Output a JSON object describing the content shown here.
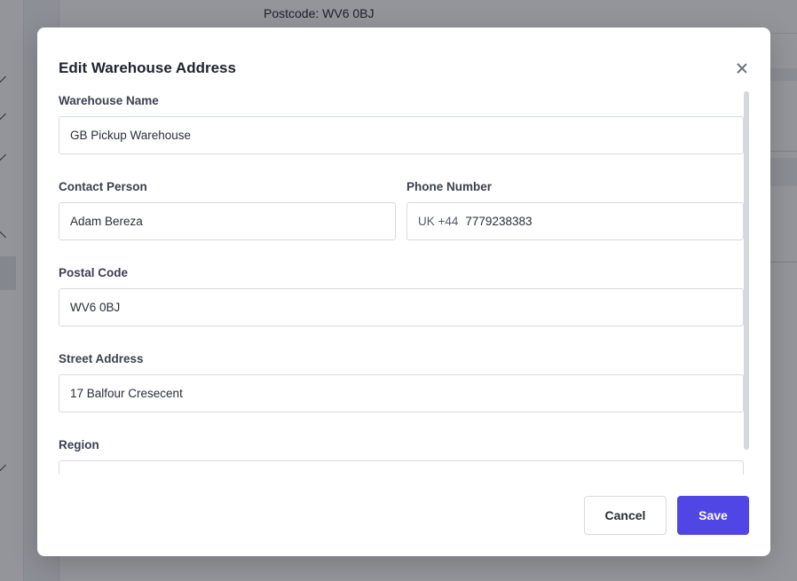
{
  "background": {
    "postcode_text": "Postcode: WV6 0BJ"
  },
  "modal": {
    "title": "Edit Warehouse Address",
    "close_icon": "close-icon",
    "fields": {
      "warehouse_name": {
        "label": "Warehouse Name",
        "value": "GB Pickup Warehouse"
      },
      "contact_person": {
        "label": "Contact Person",
        "value": "Adam Bereza"
      },
      "phone_number": {
        "label": "Phone Number",
        "country_prefix": "UK +44",
        "value": "7779238383"
      },
      "postal_code": {
        "label": "Postal Code",
        "value": "WV6 0BJ"
      },
      "street_address": {
        "label": "Street Address",
        "value": "17 Balfour Cresecent"
      },
      "region": {
        "label": "Region",
        "value": ""
      }
    },
    "buttons": {
      "cancel_label": "Cancel",
      "save_label": "Save"
    },
    "colors": {
      "primary": "#4f46e5",
      "overlay": "#10141e"
    }
  }
}
